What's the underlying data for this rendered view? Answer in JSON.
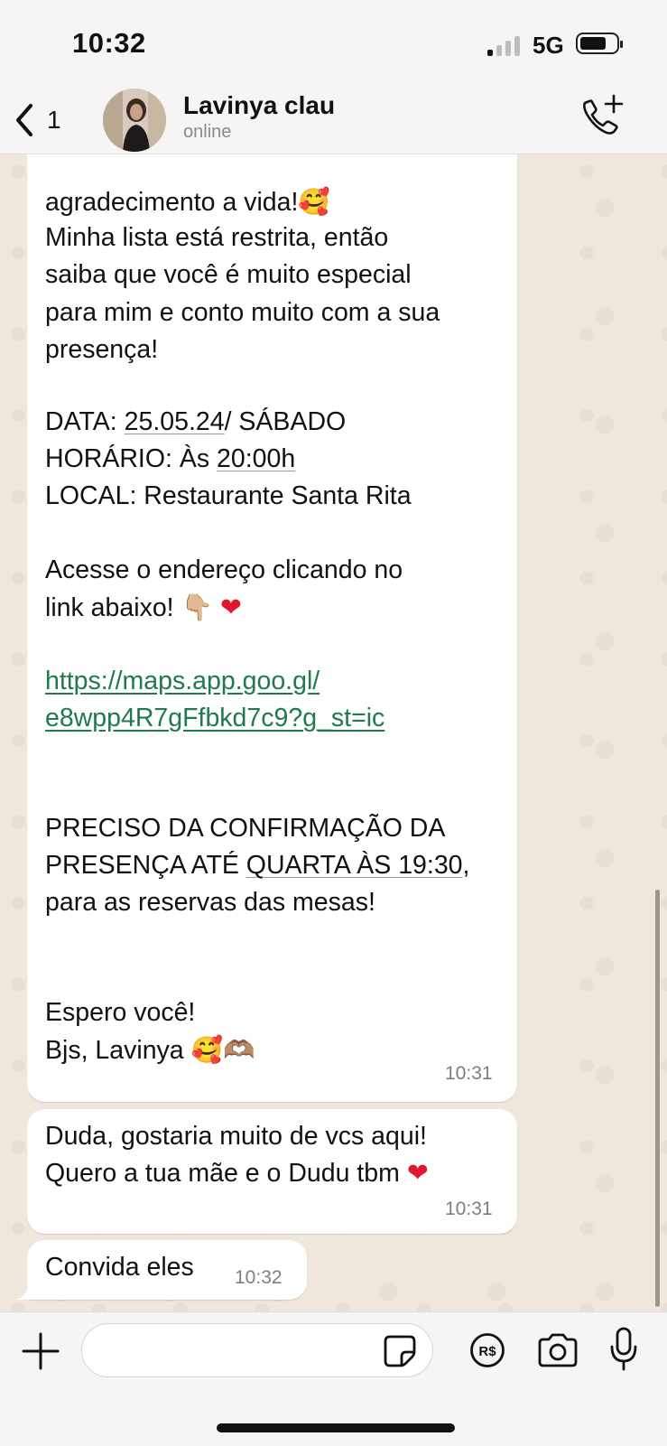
{
  "status_bar": {
    "time": "10:32",
    "network": "5G"
  },
  "header": {
    "back_count": "1",
    "contact_name": "Lavinya clau",
    "contact_status": "online"
  },
  "messages": [
    {
      "direction": "incoming",
      "partial_top": "agradecimento a vida!",
      "paragraph_1": "Minha lista está restrita, então\nsaiba que você é muito especial\npara mim e conto muito com a sua\npresença!",
      "date_label": "DATA: ",
      "date_value": "25.05.24",
      "date_suffix": "/ SÁBADO",
      "time_label": "HORÁRIO: Às ",
      "time_value": "20:00h",
      "location_line": "LOCAL:  Restaurante Santa Rita",
      "paragraph_2": "Acesse o endereço clicando no\nlink abaixo!",
      "link": "https://maps.app.goo.gl/\ne8wpp4R7gFfbkd7c9?g_st=ic",
      "confirm_line_1": "PRECISO DA CONFIRMAÇÃO DA",
      "confirm_prefix": "PRESENÇA ATÉ ",
      "confirm_deadline": "QUARTA ÀS 19:30",
      "confirm_suffix": ",",
      "confirm_line_3": "para as reservas das mesas!",
      "sign_1": "Espero você!",
      "sign_2": "Bjs, Lavinya",
      "time": "10:31"
    },
    {
      "direction": "incoming",
      "text_1": "Duda, gostaria muito de vcs aqui!",
      "text_2": "Quero a tua mãe e o Dudu tbm",
      "time": "10:31"
    },
    {
      "direction": "incoming",
      "text": "Convida eles",
      "time": "10:32"
    }
  ],
  "input": {
    "placeholder": ""
  },
  "icons": [
    "chevron-left-icon",
    "add-call-icon",
    "plus-icon",
    "sticker-icon",
    "payment-icon",
    "camera-icon",
    "microphone-icon"
  ],
  "colors": {
    "link": "#1f7a4c",
    "bubble": "#ffffff",
    "chat_background": "#efe6dc"
  }
}
